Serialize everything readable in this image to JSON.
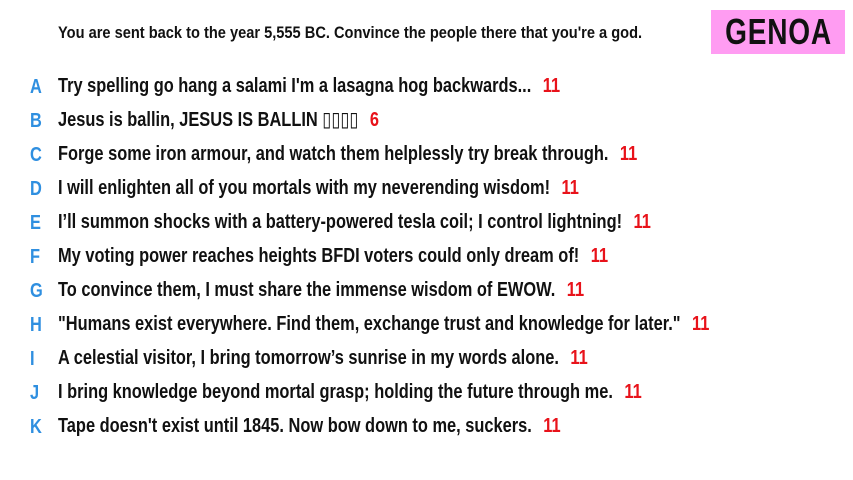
{
  "prompt": "You are sent back to the year 5,555 BC. Convince the people there that you're a god.",
  "title": "GENOA",
  "colors": {
    "letter": "#2f8fe0",
    "score": "#e8121a",
    "badge": "#ff9cf2",
    "text": "#111111"
  },
  "responses": [
    {
      "letter": "A",
      "text": "Try spelling go hang a salami I'm a lasagna hog backwards...",
      "score": "11"
    },
    {
      "letter": "B",
      "text": "Jesus is ballin, JESUS IS BALLIN ▯▯▯▯",
      "score": "6"
    },
    {
      "letter": "C",
      "text": "Forge some iron armour, and watch them helplessly try break through.",
      "score": "11"
    },
    {
      "letter": "D",
      "text": "I will enlighten all of you mortals with my neverending wisdom!",
      "score": "11"
    },
    {
      "letter": "E",
      "text": "I’ll summon shocks with a battery-powered tesla coil; I control lightning!",
      "score": "11"
    },
    {
      "letter": "F",
      "text": "My voting power reaches heights BFDI voters could only dream of!",
      "score": "11"
    },
    {
      "letter": "G",
      "text": "To convince them, I must share the immense wisdom of EWOW.",
      "score": "11"
    },
    {
      "letter": "H",
      "text": "\"Humans exist everywhere. Find them, exchange trust and knowledge for later.\"",
      "score": "11"
    },
    {
      "letter": "I",
      "text": "A celestial visitor, I bring tomorrow’s sunrise in my words alone.",
      "score": "11"
    },
    {
      "letter": "J",
      "text": "I bring knowledge beyond mortal grasp; holding the future through me.",
      "score": "11"
    },
    {
      "letter": "K",
      "text": "Tape doesn't exist until 1845. Now bow down to me, suckers.",
      "score": "11"
    }
  ]
}
